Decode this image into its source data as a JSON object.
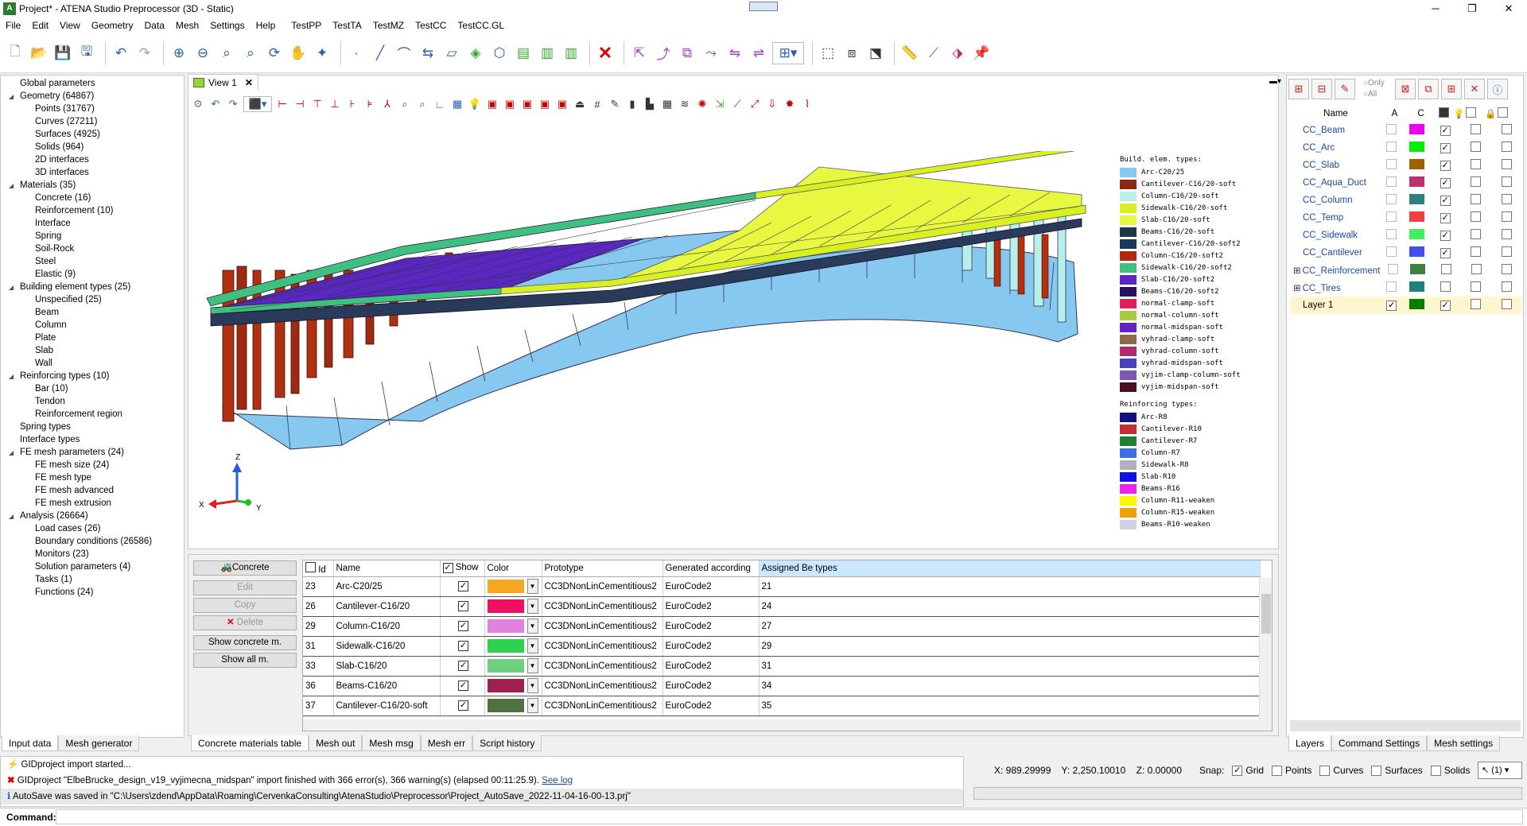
{
  "window": {
    "title": "Project* - ATENA Studio Preprocessor (3D - Static)"
  },
  "menu": [
    "File",
    "Edit",
    "View",
    "Geometry",
    "Data",
    "Mesh",
    "Settings",
    "Help",
    "TestPP",
    "TestTA",
    "TestMZ",
    "TestCC",
    "TestCC.GL"
  ],
  "toolbar_icons": [
    "new-icon",
    "open-icon",
    "save-icon",
    "save-as-icon",
    "undo-icon",
    "redo-icon",
    "zoom-in-icon",
    "zoom-out-icon",
    "zoom-all-icon",
    "zoom-selection-icon",
    "rotate-icon",
    "pan-icon",
    "wand-icon",
    "point-icon",
    "line-icon",
    "arc-icon",
    "polyline-icon",
    "surface-icon",
    "plane-icon",
    "volume-icon",
    "section-icon",
    "slab-icon",
    "delete-icon",
    "select-icon",
    "select-edit-icon",
    "select-copy-icon",
    "select-move-icon",
    "mirror-icon",
    "measure-dropdown-icon",
    "group-icon",
    "ungroup-icon",
    "transform-icon",
    "ruler-icon",
    "node-icon",
    "reinforcement-icon",
    "pin-icon"
  ],
  "tree": [
    {
      "label": "Global parameters",
      "level": 0,
      "exp": false
    },
    {
      "label": "Geometry (64867)",
      "level": 0,
      "exp": true
    },
    {
      "label": "Points (31767)",
      "level": 1
    },
    {
      "label": "Curves (27211)",
      "level": 1
    },
    {
      "label": "Surfaces (4925)",
      "level": 1
    },
    {
      "label": "Solids (964)",
      "level": 1
    },
    {
      "label": "2D interfaces",
      "level": 1
    },
    {
      "label": "3D interfaces",
      "level": 1
    },
    {
      "label": "Materials (35)",
      "level": 0,
      "exp": true
    },
    {
      "label": "Concrete (16)",
      "level": 1
    },
    {
      "label": "Reinforcement (10)",
      "level": 1
    },
    {
      "label": "Interface",
      "level": 1
    },
    {
      "label": "Spring",
      "level": 1
    },
    {
      "label": "Soil-Rock",
      "level": 1
    },
    {
      "label": "Steel",
      "level": 1
    },
    {
      "label": "Elastic (9)",
      "level": 1
    },
    {
      "label": "Building element types (25)",
      "level": 0,
      "exp": true
    },
    {
      "label": "Unspecified  (25)",
      "level": 1
    },
    {
      "label": "Beam",
      "level": 1
    },
    {
      "label": "Column",
      "level": 1
    },
    {
      "label": "Plate",
      "level": 1
    },
    {
      "label": "Slab",
      "level": 1
    },
    {
      "label": "Wall",
      "level": 1
    },
    {
      "label": "Reinforcing types  (10)",
      "level": 0,
      "exp": true
    },
    {
      "label": "Bar  (10)",
      "level": 1
    },
    {
      "label": "Tendon",
      "level": 1
    },
    {
      "label": "Reinforcement region",
      "level": 1
    },
    {
      "label": "Spring types",
      "level": 0,
      "exp": false
    },
    {
      "label": "Interface types",
      "level": 0,
      "exp": false
    },
    {
      "label": "FE mesh parameters (24)",
      "level": 0,
      "exp": true
    },
    {
      "label": "FE mesh size (24)",
      "level": 1
    },
    {
      "label": "FE mesh type",
      "level": 1
    },
    {
      "label": "FE mesh advanced",
      "level": 1
    },
    {
      "label": "FE mesh extrusion",
      "level": 1
    },
    {
      "label": "Analysis (26664)",
      "level": 0,
      "exp": true
    },
    {
      "label": "Load cases (26)",
      "level": 1
    },
    {
      "label": "Boundary conditions (26586)",
      "level": 1
    },
    {
      "label": "Monitors (23)",
      "level": 1
    },
    {
      "label": "Solution parameters (4)",
      "level": 1
    },
    {
      "label": "Tasks (1)",
      "level": 1
    },
    {
      "label": "Functions (24)",
      "level": 1
    }
  ],
  "left_tabs": [
    "Input data",
    "Mesh generator"
  ],
  "view": {
    "tab_label": "View 1",
    "close": "✕"
  },
  "legend": {
    "build_title": "Build. elem. types:",
    "build": [
      {
        "label": "Arc-C20/25",
        "color": "#87c8f0"
      },
      {
        "label": "Cantilever-C16/20-soft",
        "color": "#8b2a10"
      },
      {
        "label": "Column-C16/20-soft",
        "color": "#b7f0e8"
      },
      {
        "label": "Sidewalk-C16/20-soft",
        "color": "#d8f020"
      },
      {
        "label": "Slab-C16/20-soft",
        "color": "#e8f840"
      },
      {
        "label": "Beams-C16/20-soft",
        "color": "#1a3a4a"
      },
      {
        "label": "Cantilever-C16/20-soft2",
        "color": "#1a3a5a"
      },
      {
        "label": "Column-C16/20-soft2",
        "color": "#b02a10"
      },
      {
        "label": "Sidewalk-C16/20-soft2",
        "color": "#40c080"
      },
      {
        "label": "Slab-C16/20-soft2",
        "color": "#5a28c0"
      },
      {
        "label": "Beams-C16/20-soft2",
        "color": "#2a1060"
      },
      {
        "label": "normal-clamp-soft",
        "color": "#e0205a"
      },
      {
        "label": "normal-column-soft",
        "color": "#a8c840"
      },
      {
        "label": "normal-midspan-soft",
        "color": "#6a20c8"
      },
      {
        "label": "vyhrad-clamp-soft",
        "color": "#8a6a4a"
      },
      {
        "label": "vyhrad-column-soft",
        "color": "#b02a70"
      },
      {
        "label": "vyhrad-midspan-soft",
        "color": "#4a40c0"
      },
      {
        "label": "vyjim-clamp-column-soft",
        "color": "#7a5ab0"
      },
      {
        "label": "vyjim-midspan-soft",
        "color": "#4a1020"
      }
    ],
    "reinf_title": "Reinforcing types:",
    "reinf": [
      {
        "label": "Arc-R8",
        "color": "#101080"
      },
      {
        "label": "Cantilever-R10",
        "color": "#c03030"
      },
      {
        "label": "Cantilever-R7",
        "color": "#208030"
      },
      {
        "label": "Column-R7",
        "color": "#3a70e0"
      },
      {
        "label": "Sidewalk-R8",
        "color": "#b0b0c0"
      },
      {
        "label": "Slab-R10",
        "color": "#1010e0"
      },
      {
        "label": "Beams-R16",
        "color": "#f020f0"
      },
      {
        "label": "Column-R11-weaken",
        "color": "#f8f800"
      },
      {
        "label": "Column-R15-weaken",
        "color": "#f0a000"
      },
      {
        "label": "Beams-R10-weaken",
        "color": "#d0d0e0"
      }
    ]
  },
  "axes": {
    "z": "Z",
    "x": "X",
    "y": "Y"
  },
  "material_buttons": {
    "concrete": "Concrete",
    "edit": "Edit",
    "copy": "Copy",
    "delete": "Delete",
    "show_concrete": "Show concrete m.",
    "show_all": "Show all m."
  },
  "materials_table": {
    "headers": {
      "id": "Id",
      "name": "Name",
      "show": "Show",
      "color": "Color",
      "prototype": "Prototype",
      "generated": "Generated according",
      "assigned": "Assigned Be types"
    },
    "rows": [
      {
        "id": "23",
        "name": "Arc-C20/25",
        "color": "#f5a623",
        "prototype": "CC3DNonLinCementitious2",
        "generated": "EuroCode2",
        "assigned": "21"
      },
      {
        "id": "26",
        "name": "Cantilever-C16/20",
        "color": "#f01060",
        "prototype": "CC3DNonLinCementitious2",
        "generated": "EuroCode2",
        "assigned": "24"
      },
      {
        "id": "29",
        "name": "Column-C16/20",
        "color": "#e080e0",
        "prototype": "CC3DNonLinCementitious2",
        "generated": "EuroCode2",
        "assigned": "27"
      },
      {
        "id": "31",
        "name": "Sidewalk-C16/20",
        "color": "#30d050",
        "prototype": "CC3DNonLinCementitious2",
        "generated": "EuroCode2",
        "assigned": "29"
      },
      {
        "id": "33",
        "name": "Slab-C16/20",
        "color": "#70d080",
        "prototype": "CC3DNonLinCementitious2",
        "generated": "EuroCode2",
        "assigned": "31"
      },
      {
        "id": "36",
        "name": "Beams-C16/20",
        "color": "#a02050",
        "prototype": "CC3DNonLinCementitious2",
        "generated": "EuroCode2",
        "assigned": "34"
      },
      {
        "id": "37",
        "name": "Cantilever-C16/20-soft",
        "color": "#507040",
        "prototype": "CC3DNonLinCementitious2",
        "generated": "EuroCode2",
        "assigned": "35"
      }
    ]
  },
  "center_tabs": [
    "Concrete materials table",
    "Mesh out",
    "Mesh msg",
    "Mesh err",
    "Script history"
  ],
  "layers_panel": {
    "only": "Only",
    "all": "All",
    "headers": {
      "name": "Name",
      "a": "A",
      "c": "C"
    },
    "layers": [
      {
        "name": "CC_Beam",
        "color": "#f000f0",
        "a": false,
        "c": true,
        "expand": false
      },
      {
        "name": "CC_Arc",
        "color": "#00f000",
        "a": false,
        "c": true,
        "expand": false
      },
      {
        "name": "CC_Slab",
        "color": "#a06000",
        "a": false,
        "c": true,
        "expand": false
      },
      {
        "name": "CC_Aqua_Duct",
        "color": "#c03070",
        "a": false,
        "c": true,
        "expand": false
      },
      {
        "name": "CC_Column",
        "color": "#308080",
        "a": false,
        "c": true,
        "expand": false
      },
      {
        "name": "CC_Temp",
        "color": "#f04040",
        "a": false,
        "c": true,
        "expand": false
      },
      {
        "name": "CC_Sidewalk",
        "color": "#40f060",
        "a": false,
        "c": true,
        "expand": false
      },
      {
        "name": "CC_Cantilever",
        "color": "#4050f0",
        "a": false,
        "c": true,
        "expand": false
      },
      {
        "name": "CC_Reinforcement",
        "color": "#408040",
        "a": false,
        "c": false,
        "expand": true
      },
      {
        "name": "CC_Tires",
        "color": "#208080",
        "a": false,
        "c": false,
        "expand": true
      },
      {
        "name": "Layer 1",
        "color": "#008000",
        "a": true,
        "c": true,
        "expand": false
      }
    ]
  },
  "right_tabs": [
    "Layers",
    "Command Settings",
    "Mesh settings"
  ],
  "messages": [
    {
      "icon": "⚡",
      "color": "#e0a000",
      "text": "GIDproject import started..."
    },
    {
      "icon": "✖",
      "color": "#d00000",
      "text": "GIDproject \"ElbeBrucke_design_v19_vyjimecna_midspan\" import finished with 366 error(s), 366 warning(s) (elapsed 00:11:25.9).",
      "link": "See log"
    },
    {
      "icon": "ℹ",
      "color": "#2060c0",
      "text": "AutoSave was saved in \"C:\\Users\\zdend\\AppData\\Roaming\\CervenkaConsulting\\AtenaStudio\\Preprocessor\\Project_AutoSave_2022-11-04-16-00-13.prj\""
    }
  ],
  "status": {
    "x": "X: 989.29999",
    "y": "Y: 2,250.10010",
    "z": "Z: 0.00000",
    "snap_label": "Snap:",
    "grid": "Grid",
    "points": "Points",
    "curves": "Curves",
    "surfaces": "Surfaces",
    "solids": "Solids",
    "selector": "(1)"
  },
  "command": {
    "label": "Command:"
  }
}
